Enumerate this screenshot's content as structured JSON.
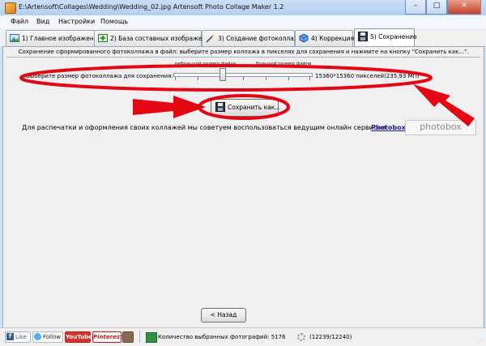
{
  "window": {
    "title": "E:\\Artensoft\\Collages\\Wedding\\Wedding_02.jpg Artensoft Photo Collage Maker 1.2",
    "controls": [
      "–",
      "□",
      "✕"
    ]
  },
  "menu": [
    "Файл",
    "Вид",
    "Настройки",
    "Помощь"
  ],
  "tabs": [
    {
      "label": "1) Главное изображение",
      "icon": "image-icon"
    },
    {
      "label": "2) База составных изображений",
      "icon": "image-plus-icon"
    },
    {
      "label": "3) Создание фотоколлажа",
      "icon": "magic-wand-icon"
    },
    {
      "label": "4) Коррекция",
      "icon": "cube-icon"
    },
    {
      "label": "5) Сохранение",
      "icon": "disk-icon",
      "active": true
    }
  ],
  "save_page": {
    "instruction": "Сохранение сформированного фотоколлажа в файл: выберите размер коллажа в пикселях для сохранения и нажмите на кнопку \"Сохранить как...\".",
    "size_label": "Выберите размер фотоколлажа для сохранения:",
    "hint_small": "небольшой размер файла",
    "hint_large": "большой размер файла",
    "size_value": "15360*15360 пикселей(235,93 МП)",
    "slider_position": 0.35,
    "save_button": "Сохранить как...",
    "promo_text": "Для распечатки и оформления своих коллажей мы советуем воспользоваться ведущим онлайн сервисом:",
    "promo_link": "Photobox",
    "logo_text": "photobox",
    "back_button": "< Назад"
  },
  "status": {
    "facebook": "Like",
    "twitter": "Follow",
    "youtube": "YouTube",
    "pinterest": "Pinterest",
    "photos_count": "Количество выбранных фотографий: 5176",
    "progress": "(12239/12240)"
  },
  "colors": {
    "annotation_red": "#e30613",
    "link_blue": "#1f1f9f",
    "title_bar": "#b4d0ef"
  }
}
